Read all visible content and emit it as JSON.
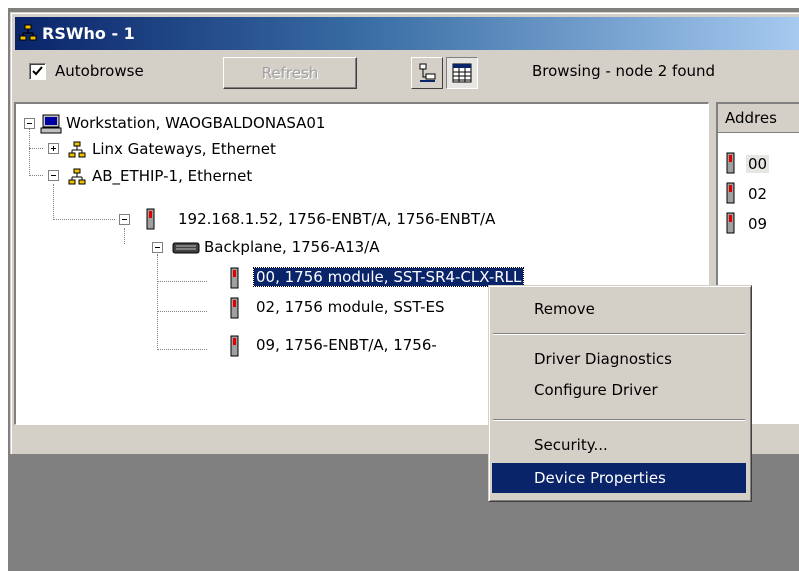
{
  "window": {
    "title": "RSWho - 1"
  },
  "toolbar": {
    "autobrowse_label": "Autobrowse",
    "autobrowse_checked": true,
    "refresh_label": "Refresh",
    "status_text": "Browsing - node 2 found"
  },
  "tree": {
    "workstation": "Workstation, WAOGBALDONASA01",
    "linx": "Linx Gateways, Ethernet",
    "ab_ethip": "AB_ETHIP-1, Ethernet",
    "enbt": "192.168.1.52, 1756-ENBT/A, 1756-ENBT/A",
    "backplane": "Backplane, 1756-A13/A",
    "slot00": "00, 1756 module, SST-SR4-CLX-RLL",
    "slot02": "02, 1756 module, SST-ES",
    "slot09": "09, 1756-ENBT/A, 1756-"
  },
  "list": {
    "header": "Addres",
    "rows": [
      "00",
      "02",
      "09"
    ]
  },
  "context_menu": {
    "items": [
      "Remove",
      "Driver Diagnostics",
      "Configure Driver",
      "Security...",
      "Device Properties"
    ],
    "highlighted": "Device Properties"
  }
}
